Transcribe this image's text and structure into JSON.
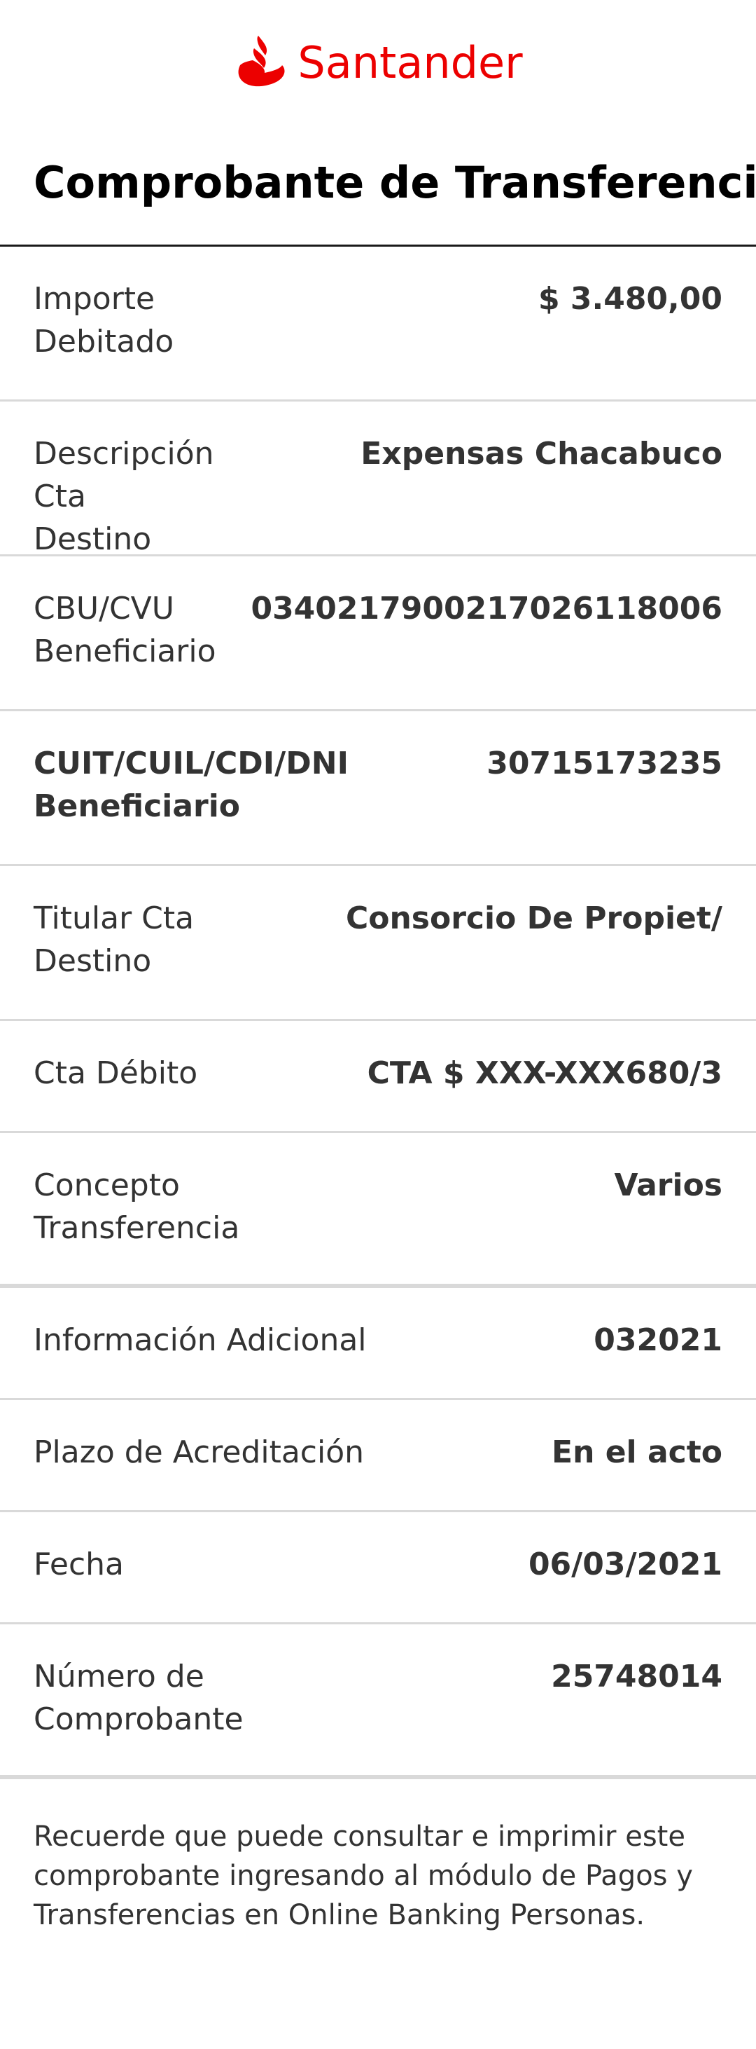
{
  "brand": {
    "name": "Santander",
    "color": "#ec0000",
    "icon": "flame-logo-icon"
  },
  "page": {
    "title": "Comprobante de Transferencia"
  },
  "details": [
    {
      "label_line1": "Importe",
      "label_line2": "Debitado",
      "value": "$ 3.480,00"
    },
    {
      "label_line1": "Descripción Cta",
      "label_line2": "Destino",
      "value": "Expensas Chacabuco"
    },
    {
      "label_line1": "CBU/CVU",
      "label_line2": "Beneficiario",
      "value": "0340217900217026118006"
    },
    {
      "label_line1": "CUIT/CUIL/CDI/DNI",
      "label_line2": "Beneficiario",
      "value": "30715173235"
    },
    {
      "label_line1": "Titular Cta",
      "label_line2": "Destino",
      "value": "Consorcio De Propiet/"
    },
    {
      "label_line1": "Cta Débito",
      "label_line2": "",
      "value": "CTA $ XXX-XXX680/3"
    },
    {
      "label_line1": "Concepto",
      "label_line2": "Transferencia",
      "value": "Varios"
    },
    {
      "label_line1": "Información Adicional",
      "label_line2": "",
      "value": "032021"
    },
    {
      "label_line1": "Plazo de Acreditación",
      "label_line2": "",
      "value": "En el acto"
    },
    {
      "label_line1": "Fecha",
      "label_line2": "",
      "value": "06/03/2021"
    },
    {
      "label_line1": "Número de",
      "label_line2": "Comprobante",
      "value": "25748014"
    }
  ],
  "footer": {
    "note_line1": "Recuerde que puede consultar e imprimir este",
    "note_line2": "comprobante ingresando al módulo de Pagos y",
    "note_line3": "Transferencias en Online Banking Personas."
  }
}
